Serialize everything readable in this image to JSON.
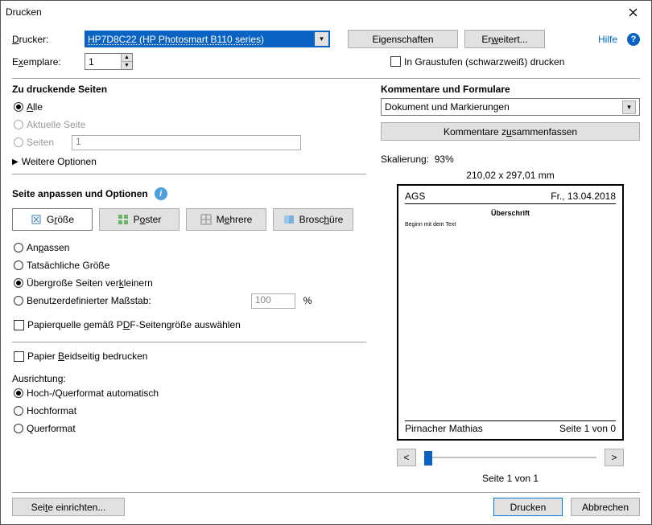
{
  "window": {
    "title": "Drucken"
  },
  "header": {
    "printer_label": "Drucker:",
    "printer_value": "HP7D8C22 (HP Photosmart B110 series)",
    "properties_btn": "Eigenschaften",
    "advanced_btn": "Erweitert...",
    "help_link": "Hilfe",
    "copies_label": "Exemplare:",
    "copies_value": "1",
    "greyscale_label": "In Graustufen (schwarzweiß) drucken"
  },
  "pages": {
    "title": "Zu druckende Seiten",
    "all": "Alle",
    "current": "Aktuelle Seite",
    "pages_label": "Seiten",
    "pages_value": "1",
    "more_options": "Weitere Optionen"
  },
  "sizing": {
    "title": "Seite anpassen und Optionen",
    "tab_size": "Größe",
    "tab_poster": "Poster",
    "tab_multiple": "Mehrere",
    "tab_booklet": "Broschüre",
    "fit": "Anpassen",
    "actual": "Tatsächliche Größe",
    "shrink": "Übergroße Seiten verkleinern",
    "custom": "Benutzerdefinierter Maßstab:",
    "custom_value": "100",
    "percent": "%",
    "paper_source": "Papierquelle gemäß PDF-Seitengröße auswählen",
    "duplex": "Papier Beidseitig bedrucken",
    "orientation_title": "Ausrichtung:",
    "orient_auto": "Hoch-/Querformat automatisch",
    "orient_portrait": "Hochformat",
    "orient_landscape": "Querformat"
  },
  "comments": {
    "title": "Kommentare und Formulare",
    "combo_value": "Dokument und Markierungen",
    "summarize_btn": "Kommentare zusammenfassen"
  },
  "preview": {
    "scale_label": "Skalierung:",
    "scale_value": "93%",
    "dimensions": "210,02 x 297,01 mm",
    "doc_header_left": "AGS",
    "doc_header_right": "Fr., 13.04.2018",
    "doc_title": "Überschrift",
    "doc_body": "Beginn mit dem Text",
    "doc_footer_left": "Pirnacher Mathias",
    "doc_footer_right": "Seite 1 von 0",
    "page_of": "Seite 1 von 1",
    "prev": "<",
    "next": ">"
  },
  "footer": {
    "page_setup": "Seite einrichten...",
    "print": "Drucken",
    "cancel": "Abbrechen"
  }
}
